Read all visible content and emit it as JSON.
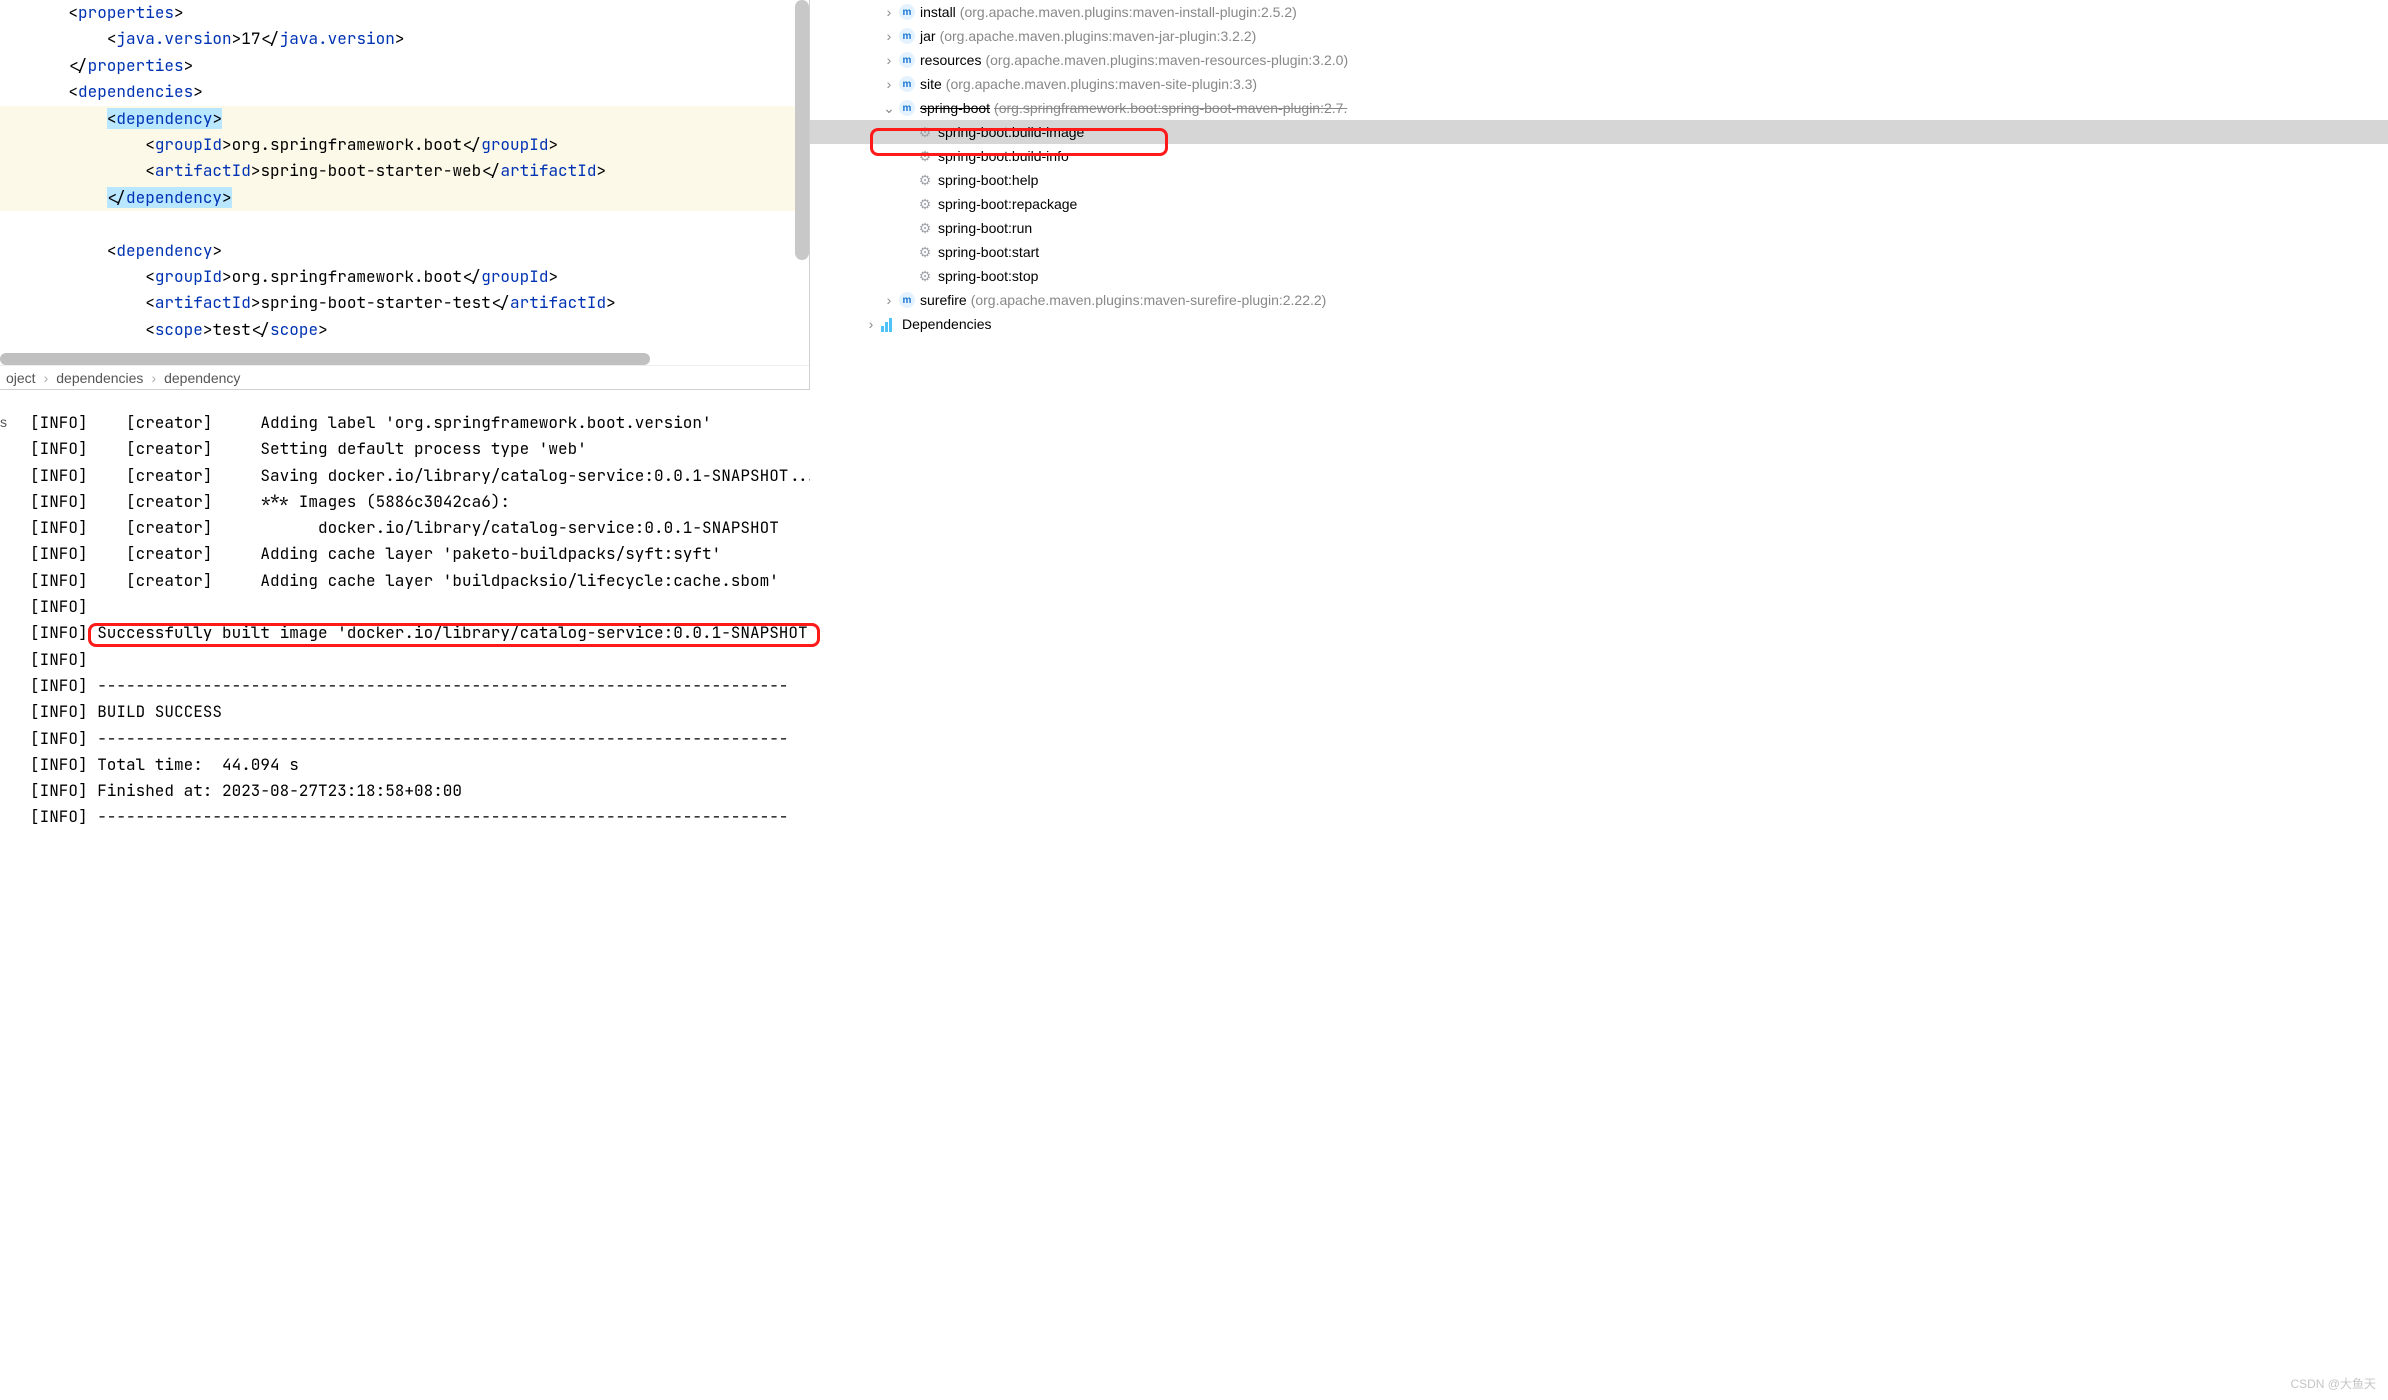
{
  "editor": {
    "lines": [
      {
        "indent": 1,
        "tokens": [
          {
            "t": "<",
            "c": "txt"
          },
          {
            "t": "properties",
            "c": "tag-blue"
          },
          {
            "t": ">",
            "c": "txt"
          }
        ]
      },
      {
        "indent": 2,
        "tokens": [
          {
            "t": "<",
            "c": "txt"
          },
          {
            "t": "java.version",
            "c": "tag-blue"
          },
          {
            "t": ">",
            "c": "txt"
          },
          {
            "t": "17",
            "c": "txt"
          },
          {
            "t": "</",
            "c": "txt"
          },
          {
            "t": "java.version",
            "c": "tag-blue"
          },
          {
            "t": ">",
            "c": "txt"
          }
        ]
      },
      {
        "indent": 1,
        "tokens": [
          {
            "t": "</",
            "c": "txt"
          },
          {
            "t": "properties",
            "c": "tag-blue"
          },
          {
            "t": ">",
            "c": "txt"
          }
        ]
      },
      {
        "indent": 1,
        "tokens": [
          {
            "t": "<",
            "c": "txt"
          },
          {
            "t": "dependencies",
            "c": "tag-blue"
          },
          {
            "t": ">",
            "c": "txt"
          }
        ]
      },
      {
        "indent": 2,
        "hl": true,
        "tokens": [
          {
            "t": "<",
            "c": "txt sel-open"
          },
          {
            "t": "dependency",
            "c": "tag-blue sel-open"
          },
          {
            "t": ">",
            "c": "txt sel-open"
          }
        ]
      },
      {
        "indent": 3,
        "hl": true,
        "tokens": [
          {
            "t": "<",
            "c": "txt"
          },
          {
            "t": "groupId",
            "c": "tag-blue"
          },
          {
            "t": ">",
            "c": "txt"
          },
          {
            "t": "org.springframework.boot",
            "c": "txt"
          },
          {
            "t": "</",
            "c": "txt"
          },
          {
            "t": "groupId",
            "c": "tag-blue"
          },
          {
            "t": ">",
            "c": "txt"
          }
        ]
      },
      {
        "indent": 3,
        "hl": true,
        "tokens": [
          {
            "t": "<",
            "c": "txt"
          },
          {
            "t": "artifactId",
            "c": "tag-blue"
          },
          {
            "t": ">",
            "c": "txt"
          },
          {
            "t": "spring-boot-starter-web",
            "c": "txt"
          },
          {
            "t": "</",
            "c": "txt"
          },
          {
            "t": "artifactId",
            "c": "tag-blue"
          },
          {
            "t": ">",
            "c": "txt"
          }
        ]
      },
      {
        "indent": 2,
        "hl": true,
        "tokens": [
          {
            "t": "</",
            "c": "txt sel-close"
          },
          {
            "t": "dependency",
            "c": "tag-blue sel-close"
          },
          {
            "t": ">",
            "c": "txt sel-close"
          }
        ]
      },
      {
        "indent": 0,
        "tokens": []
      },
      {
        "indent": 2,
        "tokens": [
          {
            "t": "<",
            "c": "txt"
          },
          {
            "t": "dependency",
            "c": "tag-blue"
          },
          {
            "t": ">",
            "c": "txt"
          }
        ]
      },
      {
        "indent": 3,
        "tokens": [
          {
            "t": "<",
            "c": "txt"
          },
          {
            "t": "groupId",
            "c": "tag-blue"
          },
          {
            "t": ">",
            "c": "txt"
          },
          {
            "t": "org.springframework.boot",
            "c": "txt"
          },
          {
            "t": "</",
            "c": "txt"
          },
          {
            "t": "groupId",
            "c": "tag-blue"
          },
          {
            "t": ">",
            "c": "txt"
          }
        ]
      },
      {
        "indent": 3,
        "tokens": [
          {
            "t": "<",
            "c": "txt"
          },
          {
            "t": "artifactId",
            "c": "tag-blue"
          },
          {
            "t": ">",
            "c": "txt"
          },
          {
            "t": "spring-boot-starter-test",
            "c": "txt"
          },
          {
            "t": "</",
            "c": "txt"
          },
          {
            "t": "artifactId",
            "c": "tag-blue"
          },
          {
            "t": ">",
            "c": "txt"
          }
        ]
      },
      {
        "indent": 3,
        "tokens": [
          {
            "t": "<",
            "c": "txt"
          },
          {
            "t": "scope",
            "c": "tag-blue"
          },
          {
            "t": ">",
            "c": "txt"
          },
          {
            "t": "test",
            "c": "txt"
          },
          {
            "t": "</",
            "c": "txt"
          },
          {
            "t": "scope",
            "c": "tag-blue"
          },
          {
            "t": ">",
            "c": "txt"
          }
        ]
      }
    ]
  },
  "breadcrumb": [
    "oject",
    "dependencies",
    "dependency"
  ],
  "tree": [
    {
      "depth": 3,
      "arrow": "›",
      "icon": "m",
      "label": "install",
      "suffix": "(org.apache.maven.plugins:maven-install-plugin:2.5.2)"
    },
    {
      "depth": 3,
      "arrow": "›",
      "icon": "m",
      "label": "jar",
      "suffix": "(org.apache.maven.plugins:maven-jar-plugin:3.2.2)"
    },
    {
      "depth": 3,
      "arrow": "›",
      "icon": "m",
      "label": "resources",
      "suffix": "(org.apache.maven.plugins:maven-resources-plugin:3.2.0)"
    },
    {
      "depth": 3,
      "arrow": "›",
      "icon": "m",
      "label": "site",
      "suffix": "(org.apache.maven.plugins:maven-site-plugin:3.3)"
    },
    {
      "depth": 3,
      "arrow": "⌄",
      "icon": "m",
      "label": "spring-boot",
      "suffix": "(org.springframework.boot:spring-boot-maven-plugin:2.7.",
      "strike": true
    },
    {
      "depth": 4,
      "arrow": "",
      "icon": "gear",
      "label": "spring-boot:build-image",
      "suffix": "",
      "selected": true
    },
    {
      "depth": 4,
      "arrow": "",
      "icon": "gear",
      "label": "spring-boot:build-info",
      "suffix": ""
    },
    {
      "depth": 4,
      "arrow": "",
      "icon": "gear",
      "label": "spring-boot:help",
      "suffix": ""
    },
    {
      "depth": 4,
      "arrow": "",
      "icon": "gear",
      "label": "spring-boot:repackage",
      "suffix": ""
    },
    {
      "depth": 4,
      "arrow": "",
      "icon": "gear",
      "label": "spring-boot:run",
      "suffix": ""
    },
    {
      "depth": 4,
      "arrow": "",
      "icon": "gear",
      "label": "spring-boot:start",
      "suffix": ""
    },
    {
      "depth": 4,
      "arrow": "",
      "icon": "gear",
      "label": "spring-boot:stop",
      "suffix": ""
    },
    {
      "depth": 3,
      "arrow": "›",
      "icon": "m",
      "label": "surefire",
      "suffix": "(org.apache.maven.plugins:maven-surefire-plugin:2.22.2)"
    },
    {
      "depth": 2,
      "arrow": "›",
      "icon": "bars",
      "label": "Dependencies",
      "suffix": ""
    }
  ],
  "console": [
    "[INFO]    [creator]     Adding label 'org.springframework.boot.version'",
    "[INFO]    [creator]     Setting default process type 'web'",
    "[INFO]    [creator]     Saving docker.io/library/catalog-service:0.0.1-SNAPSHOT...",
    "[INFO]    [creator]     *** Images (5886c3042ca6):",
    "[INFO]    [creator]           docker.io/library/catalog-service:0.0.1-SNAPSHOT",
    "[INFO]    [creator]     Adding cache layer 'paketo-buildpacks/syft:syft'",
    "[INFO]    [creator]     Adding cache layer 'buildpacksio/lifecycle:cache.sbom'",
    "[INFO]",
    "[INFO] Successfully built image 'docker.io/library/catalog-service:0.0.1-SNAPSHOT'",
    "[INFO]",
    "[INFO] ------------------------------------------------------------------------",
    "[INFO] BUILD SUCCESS",
    "[INFO] ------------------------------------------------------------------------",
    "[INFO] Total time:  44.094 s",
    "[INFO] Finished at: 2023-08-27T23:18:58+08:00",
    "[INFO] ------------------------------------------------------------------------"
  ],
  "truncated_left": "s",
  "watermark": "CSDN @大鱼天"
}
